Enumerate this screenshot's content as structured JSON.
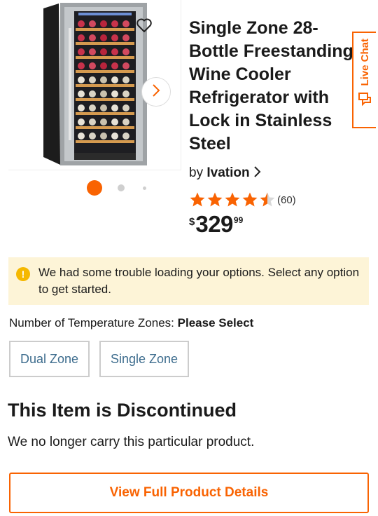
{
  "product": {
    "title": "Single Zone 28-\nBottle Freestanding\nWine Cooler\nRefrigerator with\nLock in Stainless\nSteel",
    "by_label": "by",
    "brand": "Ivation",
    "rating": 4.5,
    "rating_max": 5,
    "review_count": "(60)",
    "price": {
      "currency": "$",
      "whole": "329",
      "cents": "99"
    },
    "image_label": "Wine cooler product photo"
  },
  "gallery": {
    "dot_count": 3,
    "active_index": 0
  },
  "live_chat": {
    "label": "Live Chat"
  },
  "warning": {
    "icon": "!",
    "text": "We had some trouble loading your options. Select any option to get started."
  },
  "options": {
    "label": "Number of Temperature Zones:",
    "selected": "Please Select",
    "choices": [
      "Dual Zone",
      "Single Zone"
    ]
  },
  "discontinued": {
    "title": "This Item is Discontinued",
    "text": "We no longer carry this particular product."
  },
  "cta": {
    "label": "View Full Product Details"
  },
  "colors": {
    "accent": "#f96302",
    "warning_bg": "#fdf4d7",
    "option_text": "#3e6d8e"
  }
}
